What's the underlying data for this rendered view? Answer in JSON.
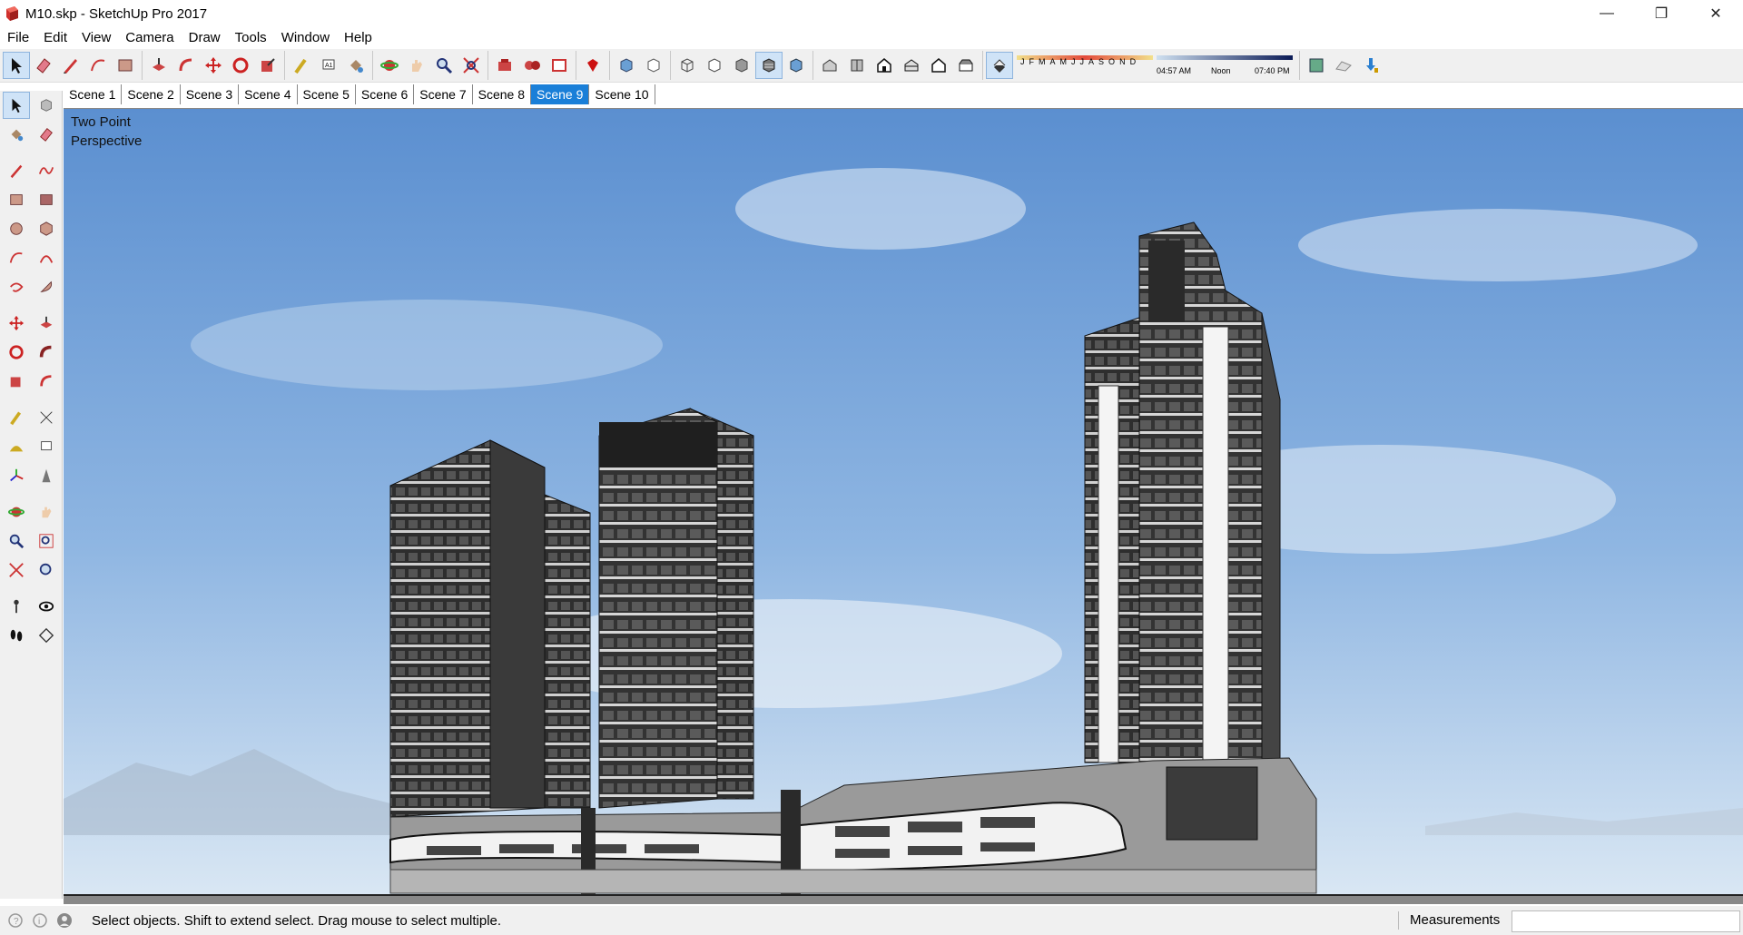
{
  "window": {
    "title": "M10.skp - SketchUp Pro 2017",
    "minimize": "—",
    "maximize": "❐",
    "close": "✕"
  },
  "menu": [
    "File",
    "Edit",
    "View",
    "Camera",
    "Draw",
    "Tools",
    "Window",
    "Help"
  ],
  "shadows": {
    "months": [
      "J",
      "F",
      "M",
      "A",
      "M",
      "J",
      "J",
      "A",
      "S",
      "O",
      "N",
      "D"
    ],
    "time_start": "04:57 AM",
    "time_noon": "Noon",
    "time_end": "07:40 PM"
  },
  "scenes": {
    "tabs": [
      "Scene 1",
      "Scene 2",
      "Scene 3",
      "Scene 4",
      "Scene 5",
      "Scene 6",
      "Scene 7",
      "Scene 8",
      "Scene 9",
      "Scene 10"
    ],
    "active_index": 8
  },
  "viewport": {
    "camera_label_line1": "Two Point",
    "camera_label_line2": "Perspective"
  },
  "status": {
    "hint": "Select objects. Shift to extend select. Drag mouse to select multiple.",
    "measurements_label": "Measurements",
    "measurements_value": ""
  },
  "colors": {
    "active_tab": "#1a7fd8",
    "sky_top": "#5b8fd0",
    "sky_bottom": "#d7e6f4"
  }
}
